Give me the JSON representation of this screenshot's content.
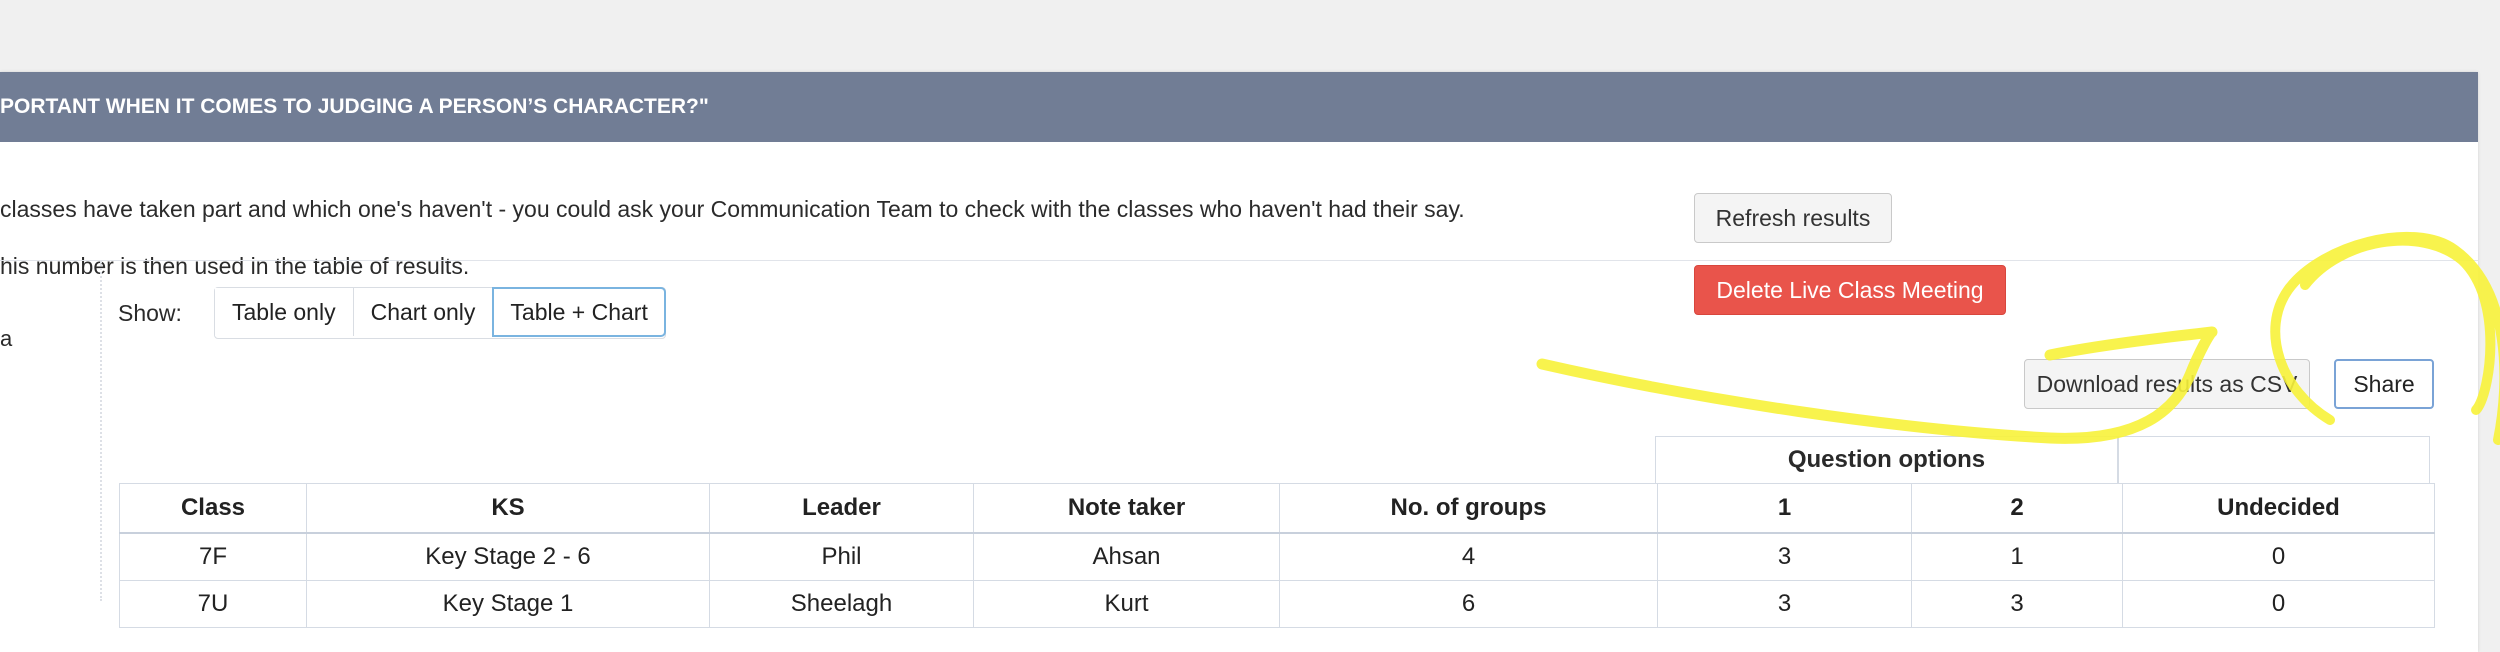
{
  "header": {
    "title": "PORTANT WHEN IT COMES TO JUDGING A PERSON’S CHARACTER?\""
  },
  "intro": {
    "line1": "classes have taken part and which one's haven't - you could ask your Communication Team to check with the classes who haven't had their say.",
    "line2": "his number is then used in the table of results."
  },
  "actions": {
    "refresh_label": "Refresh results",
    "delete_label": "Delete Live Class Meeting",
    "download_label": "Download results as CSV",
    "share_label": "Share"
  },
  "left_fragment": "a",
  "view_toggle": {
    "label": "Show:",
    "options": [
      "Table only",
      "Chart only",
      "Table + Chart"
    ],
    "selected": "Table + Chart"
  },
  "table": {
    "group_header": "Question options",
    "columns": [
      "Class",
      "KS",
      "Leader",
      "Note taker",
      "No. of groups",
      "1",
      "2",
      "Undecided"
    ],
    "rows": [
      [
        "7F",
        "Key Stage 2 - 6",
        "Phil",
        "Ahsan",
        "4",
        "3",
        "1",
        "0"
      ],
      [
        "7U",
        "Key Stage 1",
        "Sheelagh",
        "Kurt",
        "6",
        "3",
        "3",
        "0"
      ]
    ]
  },
  "colors": {
    "header_bg": "#717d95",
    "danger": "#e9544b",
    "annotation": "#f7f23a"
  }
}
